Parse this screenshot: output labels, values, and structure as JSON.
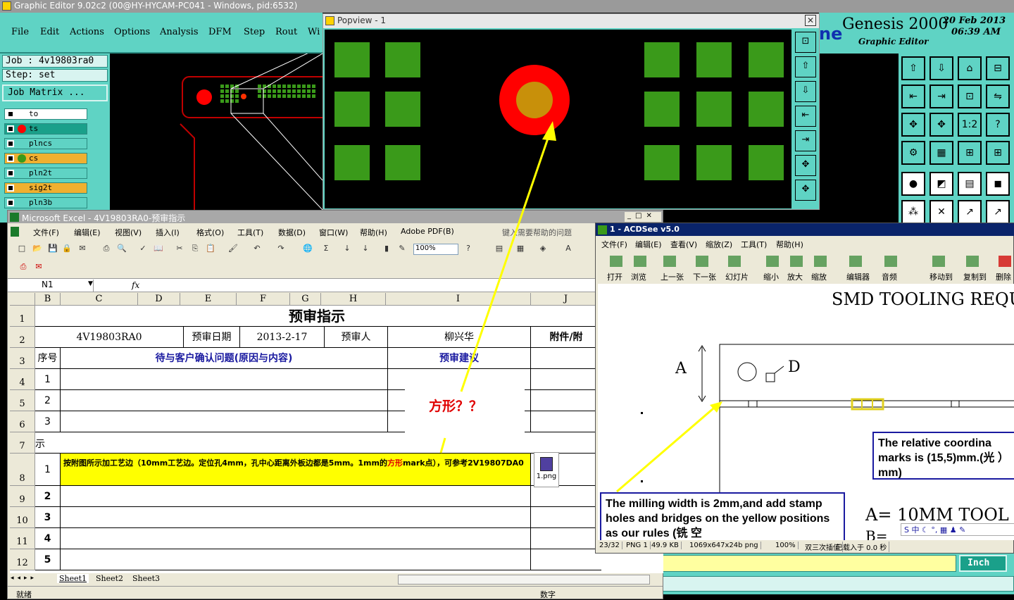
{
  "genesis": {
    "title": "Graphic Editor 9.02c2 (00@HY-HYCAM-PC041 - Windows, pid:6532)",
    "menu": [
      "File",
      "Edit",
      "Actions",
      "Options",
      "Analysis",
      "DFM",
      "Step",
      "Rout",
      "Wi"
    ],
    "job": "Job : 4v19803ra0",
    "step": "Step: set",
    "job_matrix": "Job Matrix ...",
    "layers": [
      {
        "name": "to",
        "bg": "#ffffff",
        "dot": ""
      },
      {
        "name": "ts",
        "bg": "#1aa08a",
        "dot": "#ff0000"
      },
      {
        "name": "plncs",
        "bg": "#5fd3c4",
        "dot": ""
      },
      {
        "name": "cs",
        "bg": "#f0b030",
        "dot": "#3a9a1a"
      },
      {
        "name": "pln2t",
        "bg": "#5fd3c4",
        "dot": ""
      },
      {
        "name": "sig2t",
        "bg": "#f0b030",
        "dot": ""
      },
      {
        "name": "pln3b",
        "bg": "#5fd3c4",
        "dot": ""
      }
    ],
    "brand_prefix": "ne",
    "brand": "Genesis 2000",
    "subtitle": "Graphic Editor",
    "date": "20 Feb 2013",
    "time": "06:39 AM",
    "toolbar_labels": [
      "1:2",
      "?"
    ],
    "units": "Inch"
  },
  "popview": {
    "title": "Popview - 1",
    "close": "✕"
  },
  "excel": {
    "title": "Microsoft Excel - 4V19803RA0-预审指示",
    "menu": [
      "文件(F)",
      "编辑(E)",
      "视图(V)",
      "插入(I)",
      "格式(O)",
      "工具(T)",
      "数据(D)",
      "窗口(W)",
      "帮助(H)",
      "Adobe PDF(B)"
    ],
    "help_box": "键入需要帮助的问题",
    "zoom": "100%",
    "name_box": "N1",
    "fx": "fx",
    "columns": [
      "B",
      "C",
      "D",
      "E",
      "F",
      "G",
      "H",
      "I",
      "J"
    ],
    "rows": [
      "1",
      "2",
      "3",
      "4",
      "5",
      "6",
      "7",
      "8",
      "9",
      "10",
      "11",
      "12"
    ],
    "sheet_title": "预审指示",
    "job_no": "4V19803RA0",
    "date_label": "预审日期",
    "date_value": "2013-2-17",
    "reviewer_label": "预审人",
    "reviewer": "柳兴华",
    "attach_label": "附件/附",
    "seq_label": "序号",
    "issue_header": "待与客户确认问题(原因与内容)",
    "advice_header": "预审建议",
    "seq": [
      "1",
      "2",
      "3"
    ],
    "section7": "示",
    "items": [
      "1",
      "2",
      "3",
      "4",
      "5"
    ],
    "note_pre": "按附图所示加工艺边（10mm工艺边。定位孔4mm，孔中心距离外板边都是5mm。1mm的",
    "note_red": "方形",
    "note_post": "mark点），可参考2V19807DA0",
    "attachment": "1.png",
    "callout": "方形？？",
    "tabs": [
      "Sheet1",
      "Sheet2",
      "Sheet3"
    ],
    "status_left": "就绪",
    "status_right": "数字"
  },
  "acdsee": {
    "title": "1 - ACDSee v5.0",
    "menu": [
      "文件(F)",
      "编辑(E)",
      "查看(V)",
      "缩放(Z)",
      "工具(T)",
      "帮助(H)"
    ],
    "toolbar": [
      "打开",
      "浏览",
      "上一张",
      "下一张",
      "幻灯片",
      "缩小",
      "放大",
      "缩放",
      "编辑器",
      "音频",
      "移动到",
      "复制到",
      "删除"
    ],
    "doc_heading": "SMD TOOLING REQU",
    "label_a": "A",
    "label_d": "D",
    "box1": "The relative coordina marks is (15,5)mm.(光 ）mm)",
    "box2": "The milling width is 2mm,and add stamp holes and bridges on the yellow positions as our rules (铣 空",
    "bottom_text": "A= 10MM TOOL",
    "bottom_b": "B=",
    "status": [
      "23/32",
      "PNG 1",
      "49.9 KB",
      "1069x647x24b png",
      "100%",
      "双三次插值",
      "已载入于 0.0 秒"
    ]
  }
}
